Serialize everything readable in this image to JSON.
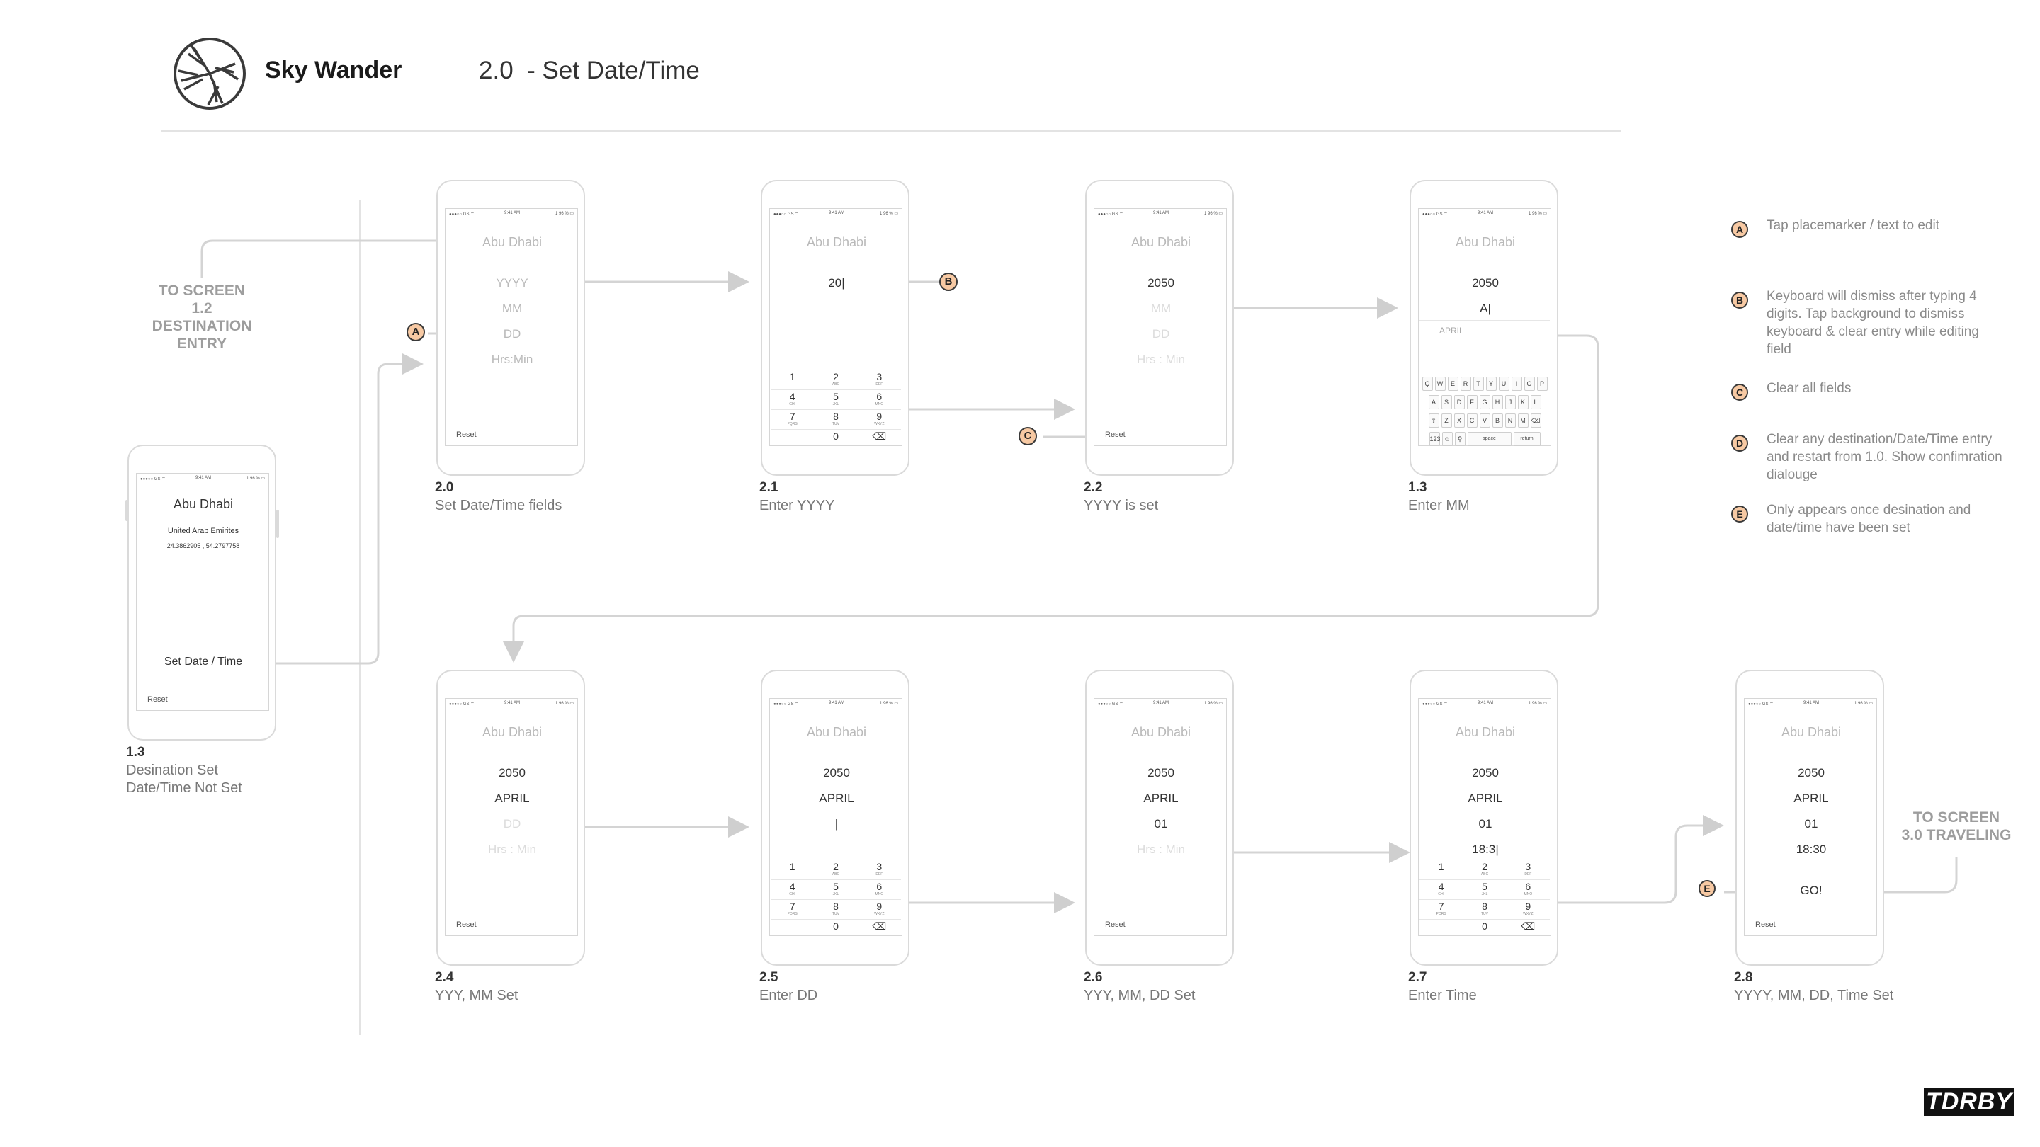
{
  "header": {
    "brand": "Sky Wander",
    "title": "2.0  - Set Date/Time"
  },
  "status": {
    "carrier": "●●●○○ GS ⌔",
    "time": "9:41 AM",
    "battery": "1 96 % ▭"
  },
  "screens": {
    "s13a": {
      "city": "Abu Dhabi",
      "country": "United Arab Emirites",
      "coords": "24.3862905 , 54.2797758",
      "set_btn": "Set Date / Time",
      "reset": "Reset",
      "num": "1.3",
      "caption1": "Desination Set",
      "caption2": "Date/Time Not Set"
    },
    "s20": {
      "city": "Abu Dhabi",
      "yyyy": "YYYY",
      "mm": "MM",
      "dd": "DD",
      "hrs": "Hrs:Min",
      "reset": "Reset",
      "num": "2.0",
      "caption": "Set Date/Time fields"
    },
    "s21": {
      "city": "Abu Dhabi",
      "entry": "20|",
      "num": "2.1",
      "caption": "Enter YYYY"
    },
    "s22": {
      "city": "Abu Dhabi",
      "year": "2050",
      "mm": "MM",
      "dd": "DD",
      "hrs": "Hrs : Min",
      "reset": "Reset",
      "num": "2.2",
      "caption": "YYYY is set"
    },
    "s13b": {
      "city": "Abu Dhabi",
      "year": "2050",
      "entry": "A|",
      "suggest": "APRIL",
      "num": "1.3",
      "caption": "Enter MM"
    },
    "s24": {
      "city": "Abu Dhabi",
      "year": "2050",
      "month": "APRIL",
      "dd": "DD",
      "hrs": "Hrs : Min",
      "reset": "Reset",
      "num": "2.4",
      "caption": "YYY, MM Set"
    },
    "s25": {
      "city": "Abu Dhabi",
      "year": "2050",
      "month": "APRIL",
      "entry": "|",
      "num": "2.5",
      "caption": "Enter DD"
    },
    "s26": {
      "city": "Abu Dhabi",
      "year": "2050",
      "month": "APRIL",
      "day": "01",
      "hrs": "Hrs : Min",
      "reset": "Reset",
      "num": "2.6",
      "caption": "YYY, MM, DD Set"
    },
    "s27": {
      "city": "Abu Dhabi",
      "year": "2050",
      "month": "APRIL",
      "day": "01",
      "entry": "18:3|",
      "num": "2.7",
      "caption": "Enter Time"
    },
    "s28": {
      "city": "Abu Dhabi",
      "year": "2050",
      "month": "APRIL",
      "day": "01",
      "time": "18:30",
      "go": "GO!",
      "reset": "Reset",
      "num": "2.8",
      "caption": "YYYY, MM, DD, Time Set"
    }
  },
  "keypad": {
    "row1": [
      [
        "1",
        ""
      ],
      [
        "2",
        "ABC"
      ],
      [
        "3",
        "DEF"
      ]
    ],
    "row2": [
      [
        "4",
        "GHI"
      ],
      [
        "5",
        "JKL"
      ],
      [
        "6",
        "MNO"
      ]
    ],
    "row3": [
      [
        "7",
        "PQRS"
      ],
      [
        "8",
        "TUV"
      ],
      [
        "9",
        "WXYZ"
      ]
    ],
    "row4": [
      "",
      "0",
      "⌫"
    ]
  },
  "qwerty": {
    "row1": [
      "Q",
      "W",
      "E",
      "R",
      "T",
      "Y",
      "U",
      "I",
      "O",
      "P"
    ],
    "row2": [
      "A",
      "S",
      "D",
      "F",
      "G",
      "H",
      "J",
      "K",
      "L"
    ],
    "row3": [
      "⇧",
      "Z",
      "X",
      "C",
      "V",
      "B",
      "N",
      "M",
      "⌫"
    ],
    "row4": [
      "123",
      "☺",
      "🎤",
      "space",
      "return"
    ]
  },
  "annotations": {
    "to_screen_left": [
      "TO SCREEN",
      "1.2",
      "DESTINATION",
      "ENTRY"
    ],
    "to_screen_right": [
      "TO SCREEN",
      "3.0 TRAVELING"
    ]
  },
  "legend": [
    {
      "key": "A",
      "text": "Tap placemarker / text to edit"
    },
    {
      "key": "B",
      "text": "Keyboard will dismiss after typing 4 digits. Tap background to dismiss keyboard & clear entry while editing field"
    },
    {
      "key": "C",
      "text": "Clear all fields"
    },
    {
      "key": "D",
      "text": "Clear any destination/Date/Time entry and restart from 1.0. Show confimration dialouge"
    },
    {
      "key": "E",
      "text": "Only appears once desination and date/time have been set"
    }
  ],
  "colors": {
    "marker_fill": "#f7c9a3",
    "wire": "#d4d4d4",
    "caption": "#777777"
  },
  "footer": {
    "badge": "TDRBY"
  }
}
